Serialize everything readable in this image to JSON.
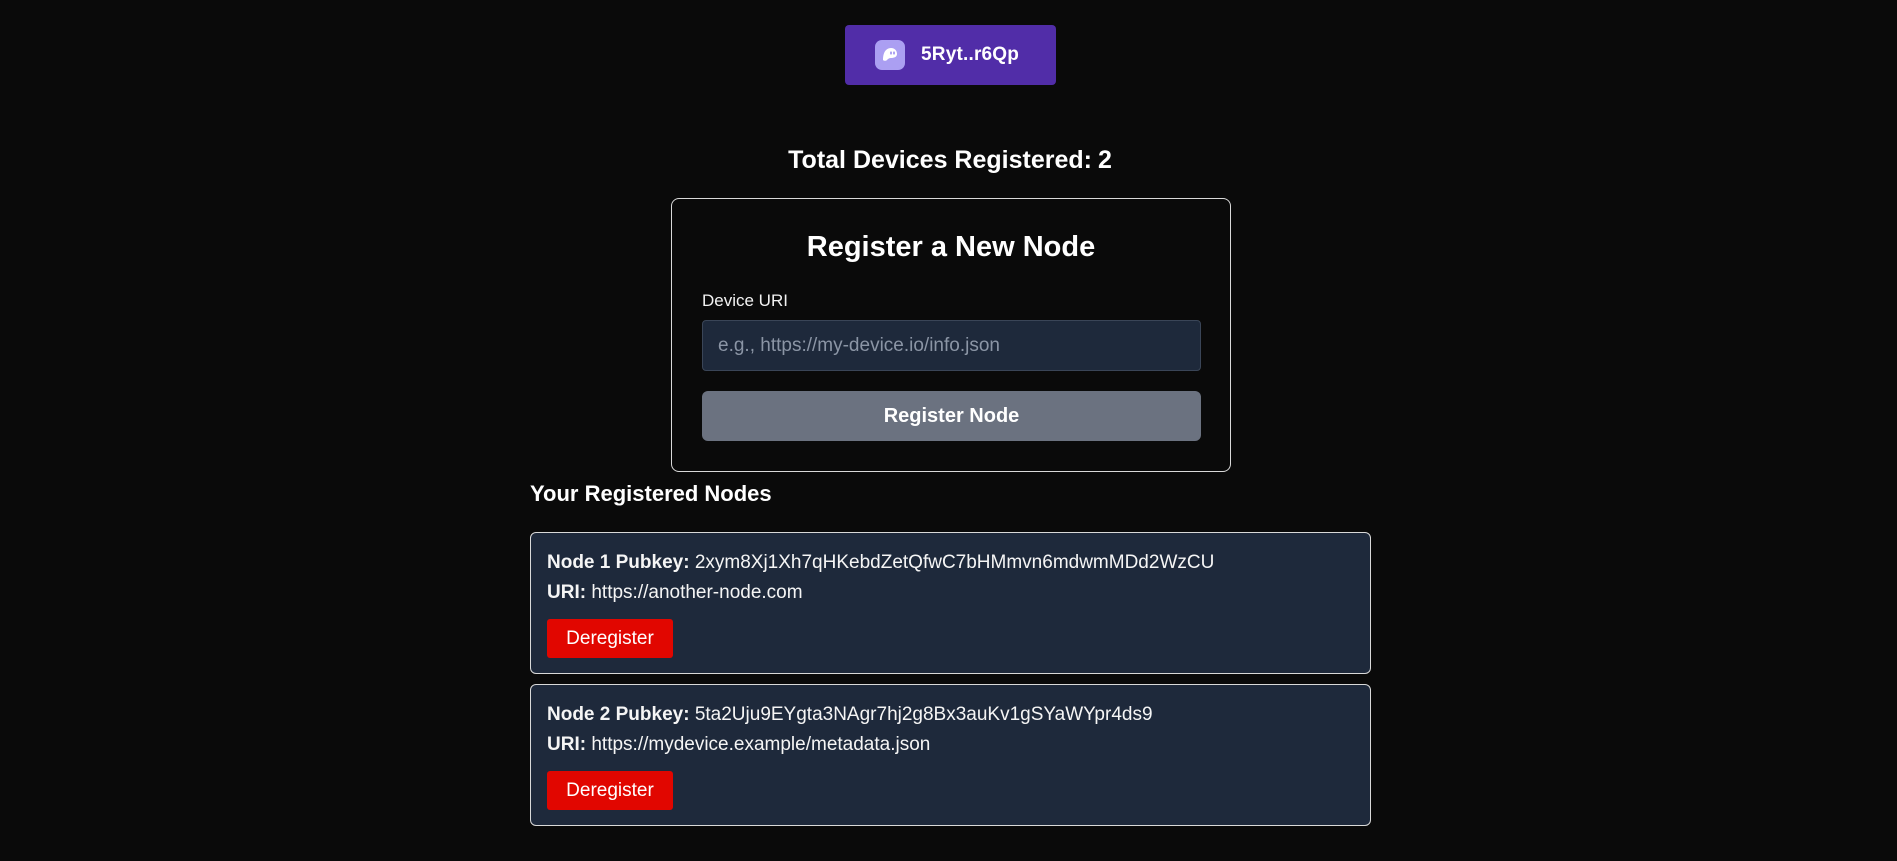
{
  "wallet": {
    "address_label": "5Ryt..r6Qp",
    "icon": "ghost-icon",
    "accent": "#512da8"
  },
  "stats": {
    "total_label": "Total Devices Registered:",
    "total_count": "2"
  },
  "register": {
    "title": "Register a New Node",
    "field_label": "Device URI",
    "placeholder": "e.g., https://my-device.io/info.json",
    "value": "",
    "button_label": "Register Node"
  },
  "nodes_section": {
    "title": "Your Registered Nodes",
    "items": [
      {
        "pubkey_label": "Node 1 Pubkey:",
        "pubkey": "2xym8Xj1Xh7qHKebdZetQfwC7bHMmvn6mdwmMDd2WzCU",
        "uri_label": "URI:",
        "uri": "https://another-node.com",
        "deregister_label": "Deregister"
      },
      {
        "pubkey_label": "Node 2 Pubkey:",
        "pubkey": "5ta2Uju9EYgta3NAgr7hj2g8Bx3auKv1gSYaWYpr4ds9",
        "uri_label": "URI:",
        "uri": "https://mydevice.example/metadata.json",
        "deregister_label": "Deregister"
      }
    ]
  },
  "colors": {
    "background": "#0a0a0a",
    "card": "#1e293b",
    "danger": "#e10600",
    "disabled_button": "#6b7280"
  }
}
